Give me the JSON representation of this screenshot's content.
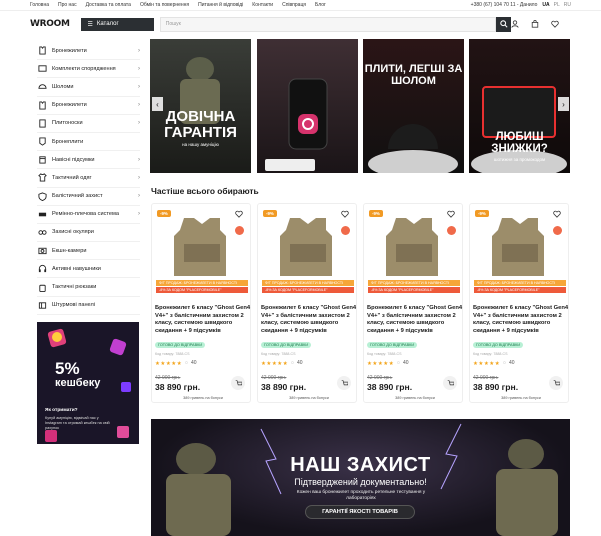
{
  "topbar": {
    "links": [
      "Головна",
      "Про нас",
      "Доставка та оплата",
      "Обмін та повернення",
      "Питання й відповіді",
      "Контакти",
      "Співпраця",
      "Блог"
    ],
    "phone": "+380 (67) 104 70 11 - Данило",
    "langs": [
      "UA",
      "PL",
      "RU"
    ]
  },
  "header": {
    "logo": "WROOM",
    "catalog_label": "Каталог",
    "search_placeholder": "Пошук"
  },
  "sidebar": {
    "items": [
      {
        "label": "Бронежилети",
        "chev": true
      },
      {
        "label": "Комплекти спорядження",
        "chev": true
      },
      {
        "label": "Шоломи",
        "chev": true
      },
      {
        "label": "Бронежилети",
        "chev": true
      },
      {
        "label": "Плитоноски",
        "chev": true
      },
      {
        "label": "Бронеплити",
        "chev": false
      },
      {
        "label": "Навісні підсумки",
        "chev": true
      },
      {
        "label": "Тактичний одяг",
        "chev": true
      },
      {
        "label": "Балістичний захист",
        "chev": true
      },
      {
        "label": "Ремінно-плечова система",
        "chev": true
      },
      {
        "label": "Захисні окуляри",
        "chev": false
      },
      {
        "label": "Екшн-камери",
        "chev": false
      },
      {
        "label": "Активні навушники",
        "chev": false
      },
      {
        "label": "Тактичні рюкзаки",
        "chev": false
      },
      {
        "label": "Штурмові панелі",
        "chev": false
      }
    ]
  },
  "cashback": {
    "percent": "5%",
    "word": "кешбеку",
    "question": "Як отримати?",
    "desc": "Купуй амуніцію, відмічай нас у Instagram та отримай кешбек на свій рахунок"
  },
  "banners": [
    {
      "title": "ДОВІЧНА ГАРАНТІЯ",
      "sub": "на нашу амуніцію"
    },
    {
      "title": "",
      "sub": ""
    },
    {
      "title": "ПЛИТИ, ЛЕГШІ ЗА ШОЛОМ",
      "sub": ""
    },
    {
      "title": "ЛЮБИШ ЗНИЖКИ?",
      "sub": "шотижня за промокодом"
    }
  ],
  "section_title": "Частіше всього обирають",
  "product": {
    "discount": "-9%",
    "promo1": "Ф/Т ПРОДАЖ: БРОНЕЖИЛЕТИ В НАЯВНОСТІ",
    "promo2": "-8% ЗА КОДОМ \"PLACEFORMOBILE\"",
    "name": "Бронежилет 6 класу \"Ghost Gen4 V4+\" з балістичним захистом 2 класу, системою швидкого скидання + 9 підсумків",
    "ready": "ГОТОВО ДО ВІДПРАВКИ",
    "code": "Код товару: 7888-CS",
    "stars": "★★★★★",
    "reviews": "40",
    "old_price": "42 900 грн.",
    "price": "38 890 грн.",
    "bonus": "389 гривень на бонуси"
  },
  "hero": {
    "title": "НАШ ЗАХИСТ",
    "subtitle": "Підтверджений документально!",
    "desc": "Кожен ваш бронежилет проходить ретельне тестування у лабораторіях",
    "button": "ГАРАНТІЇ ЯКОСТІ ТОВАРІВ"
  },
  "colors": {
    "dark": "#2b2f33",
    "discount": "#f19a24",
    "promo_red": "#ee5a3a",
    "ready_bg": "#b8f0d5",
    "star": "#f3a51c"
  }
}
